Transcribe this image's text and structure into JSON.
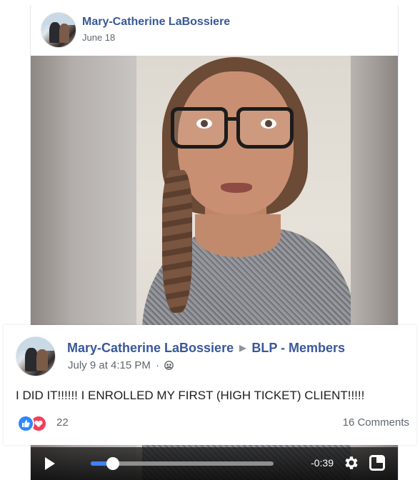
{
  "post": {
    "author": "Mary-Catherine LaBossiere",
    "date": "June 18"
  },
  "video": {
    "time_remaining": "-0:39",
    "progress_fraction": 0.12
  },
  "overlay_post": {
    "author": "Mary-Catherine LaBossiere",
    "arrow": "▶",
    "group": "BLP - Members",
    "timestamp": "July 9 at 4:15 PM",
    "separator": "·",
    "message": "I DID IT!!!!!! I ENROLLED MY FIRST (HIGH TICKET) CLIENT!!!!!",
    "reaction_count": "22",
    "comments": "16 Comments"
  },
  "colors": {
    "link": "#385898",
    "meta": "#606770",
    "like": "#2d88ff",
    "love": "#f33e58",
    "progress": "#4080ff"
  },
  "icons": [
    "avatar",
    "play-icon",
    "gear-icon",
    "fullscreen-icon",
    "group-members-icon",
    "like-icon",
    "love-icon"
  ]
}
